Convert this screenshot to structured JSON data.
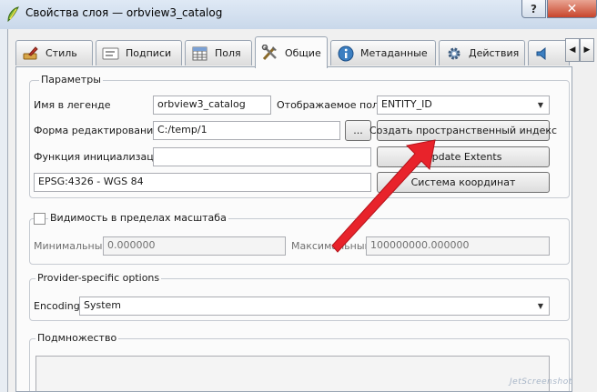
{
  "window": {
    "title": "Свойства слоя — orbview3_catalog",
    "help_label": "?",
    "close_label": "✕"
  },
  "tabs": [
    {
      "label": "Стиль",
      "icon": "paintbrush-icon"
    },
    {
      "label": "Подписи",
      "icon": "label-icon"
    },
    {
      "label": "Поля",
      "icon": "table-icon"
    },
    {
      "label": "Общие",
      "icon": "tools-icon"
    },
    {
      "label": "Метаданные",
      "icon": "info-icon"
    },
    {
      "label": "Действия",
      "icon": "gear-icon"
    },
    {
      "label": "",
      "icon": "speaker-icon"
    }
  ],
  "tab_arrows": {
    "left": "◀",
    "right": "▶"
  },
  "params": {
    "title": "Параметры",
    "legend_name_label": "Имя в легенде",
    "legend_name_value": "orbview3_catalog",
    "display_field_label": "Отображаемое поле",
    "display_field_value": "ENTITY_ID",
    "edit_form_label": "Форма редактирования",
    "edit_form_value": "C:/temp/1",
    "browse_label": "...",
    "init_func_label": "Функция инициализации",
    "init_func_value": "",
    "create_index_label": "Создать пространственный индекс",
    "update_extents_label": "Update Extents",
    "crs_value": "EPSG:4326 - WGS 84",
    "crs_button_label": "Система координат"
  },
  "scale": {
    "title": "Видимость в пределах масштаба",
    "min_label": "Минимальный",
    "min_value": "0.000000",
    "max_label": "Максимальный",
    "max_value": "100000000.000000"
  },
  "provider": {
    "title": "Provider-specific options",
    "encoding_label": "Encoding",
    "encoding_value": "System"
  },
  "subset": {
    "title": "Подмножество"
  },
  "watermark": "JetScreenshot",
  "colors": {
    "arrow": "#e8232b",
    "accent": "#3c7fc1"
  }
}
